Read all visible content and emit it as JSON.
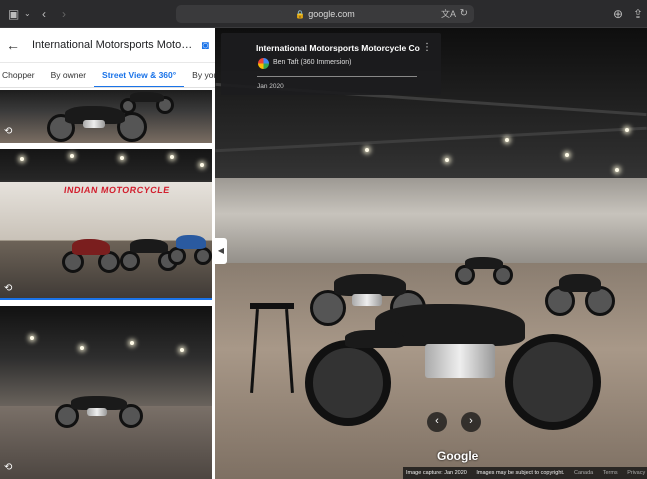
{
  "browser": {
    "url": "google.com",
    "icons": [
      "sidebar-icon",
      "chevron-down-icon",
      "back-icon",
      "forward-icon",
      "translate-icon",
      "reload-icon",
      "download-icon",
      "share-icon"
    ]
  },
  "panel": {
    "title": "International Motorsports Motorcycle Co",
    "tabs": [
      "Chopper",
      "By owner",
      "Street View & 360°",
      "By you"
    ],
    "active_tab": "Street View & 360°",
    "thumbnail_sign": "INDIAN MOTORCYCLE"
  },
  "viewer": {
    "place_name": "International Motorsports Motorcycle Co",
    "author": "Ben Taft (360 Immersion)",
    "date": "Jan 2020",
    "brand": "Google",
    "footer": {
      "capture": "Image capture: Jan 2020",
      "copyright": "Images may be subject to copyright.",
      "country": "Canada",
      "terms": "Terms",
      "privacy": "Privacy"
    }
  },
  "colors": {
    "accent": "#1a73e8",
    "sign_red": "#d21f2e"
  }
}
